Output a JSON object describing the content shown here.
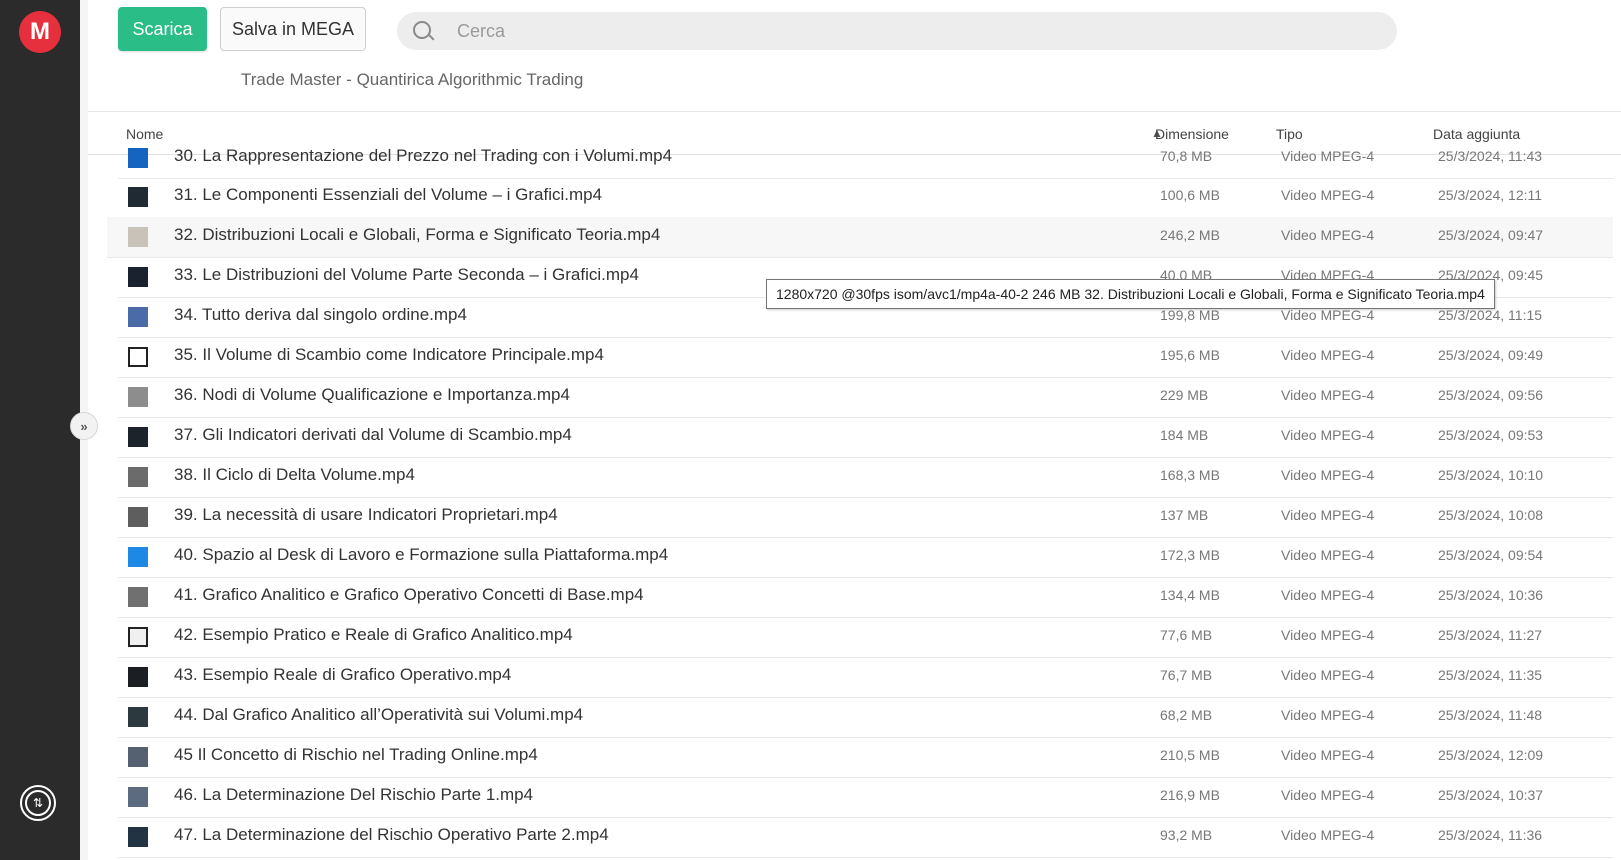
{
  "app": {
    "logo_letter": "M"
  },
  "toolbar": {
    "download_label": "Scarica",
    "save_label": "Salva in MEGA"
  },
  "search": {
    "placeholder": "Cerca"
  },
  "breadcrumb": "Trade Master - Quantirica Algorithmic Trading",
  "table": {
    "columns": {
      "name": "Nome",
      "size": "Dimensione",
      "type": "Tipo",
      "date": "Data aggiunta"
    },
    "rows": [
      {
        "name": "30. La Rappresentazione del Prezzo nel Trading con i Volumi.mp4",
        "size": "70,8 MB",
        "type": "Video MPEG-4",
        "date": "25/3/2024, 11:43",
        "thumb": "#1565c0"
      },
      {
        "name": "31. Le Componenti Essenziali del Volume – i Grafici.mp4",
        "size": "100,6 MB",
        "type": "Video MPEG-4",
        "date": "25/3/2024, 12:11",
        "thumb": "#1f2a33"
      },
      {
        "name": "32. Distribuzioni Locali e Globali, Forma e Significato Teoria.mp4",
        "size": "246,2 MB",
        "type": "Video MPEG-4",
        "date": "25/3/2024, 09:47",
        "thumb": "#c9c2b8"
      },
      {
        "name": "33. Le Distribuzioni del Volume Parte Seconda – i Grafici.mp4",
        "size": "40,0 MB",
        "type": "Video MPEG-4",
        "date": "25/3/2024, 09:45",
        "thumb": "#1a2230"
      },
      {
        "name": "34. Tutto deriva dal singolo ordine.mp4",
        "size": "199,8 MB",
        "type": "Video MPEG-4",
        "date": "25/3/2024, 11:15",
        "thumb": "#4a6aa8"
      },
      {
        "name": "35. Il Volume di Scambio come Indicatore Principale.mp4",
        "size": "195,6 MB",
        "type": "Video MPEG-4",
        "date": "25/3/2024, 09:49",
        "thumb": "#ffffff"
      },
      {
        "name": "36. Nodi di Volume Qualificazione e Importanza.mp4",
        "size": "229 MB",
        "type": "Video MPEG-4",
        "date": "25/3/2024, 09:56",
        "thumb": "#8d8d8d"
      },
      {
        "name": "37. Gli Indicatori derivati dal Volume di Scambio.mp4",
        "size": "184 MB",
        "type": "Video MPEG-4",
        "date": "25/3/2024, 09:53",
        "thumb": "#1c232b"
      },
      {
        "name": "38. Il Ciclo di Delta Volume.mp4",
        "size": "168,3 MB",
        "type": "Video MPEG-4",
        "date": "25/3/2024, 10:10",
        "thumb": "#6b6b6b"
      },
      {
        "name": "39. La necessità di usare Indicatori Proprietari.mp4",
        "size": "137 MB",
        "type": "Video MPEG-4",
        "date": "25/3/2024, 10:08",
        "thumb": "#5e5e5e"
      },
      {
        "name": "40. Spazio al Desk di Lavoro e Formazione sulla Piattaforma.mp4",
        "size": "172,3 MB",
        "type": "Video MPEG-4",
        "date": "25/3/2024, 09:54",
        "thumb": "#1e88e5"
      },
      {
        "name": "41. Grafico Analitico e Grafico Operativo Concetti di Base.mp4",
        "size": "134,4 MB",
        "type": "Video MPEG-4",
        "date": "25/3/2024, 10:36",
        "thumb": "#707070"
      },
      {
        "name": "42. Esempio Pratico e Reale di Grafico Analitico.mp4",
        "size": "77,6 MB",
        "type": "Video MPEG-4",
        "date": "25/3/2024, 11:27",
        "thumb": "#f0f0f0"
      },
      {
        "name": "43. Esempio Reale di Grafico Operativo.mp4",
        "size": "76,7 MB",
        "type": "Video MPEG-4",
        "date": "25/3/2024, 11:35",
        "thumb": "#1b1f24"
      },
      {
        "name": "44. Dal Grafico Analitico all’Operatività sui Volumi.mp4",
        "size": "68,2 MB",
        "type": "Video MPEG-4",
        "date": "25/3/2024, 11:48",
        "thumb": "#2c3a3f"
      },
      {
        "name": "45 Il Concetto di Rischio nel Trading Online.mp4",
        "size": "210,5 MB",
        "type": "Video MPEG-4",
        "date": "25/3/2024, 12:09",
        "thumb": "#556070"
      },
      {
        "name": "46. La Determinazione Del Rischio Parte 1.mp4",
        "size": "216,9 MB",
        "type": "Video MPEG-4",
        "date": "25/3/2024, 10:37",
        "thumb": "#5d6b80"
      },
      {
        "name": "47. La Determinazione del Rischio Operativo Parte 2.mp4",
        "size": "93,2 MB",
        "type": "Video MPEG-4",
        "date": "25/3/2024, 11:36",
        "thumb": "#223344"
      }
    ]
  },
  "tooltip": "1280x720 @30fps isom/avc1/mp4a-40-2 246 MB 32. Distribuzioni Locali e Globali, Forma e Significato Teoria.mp4"
}
